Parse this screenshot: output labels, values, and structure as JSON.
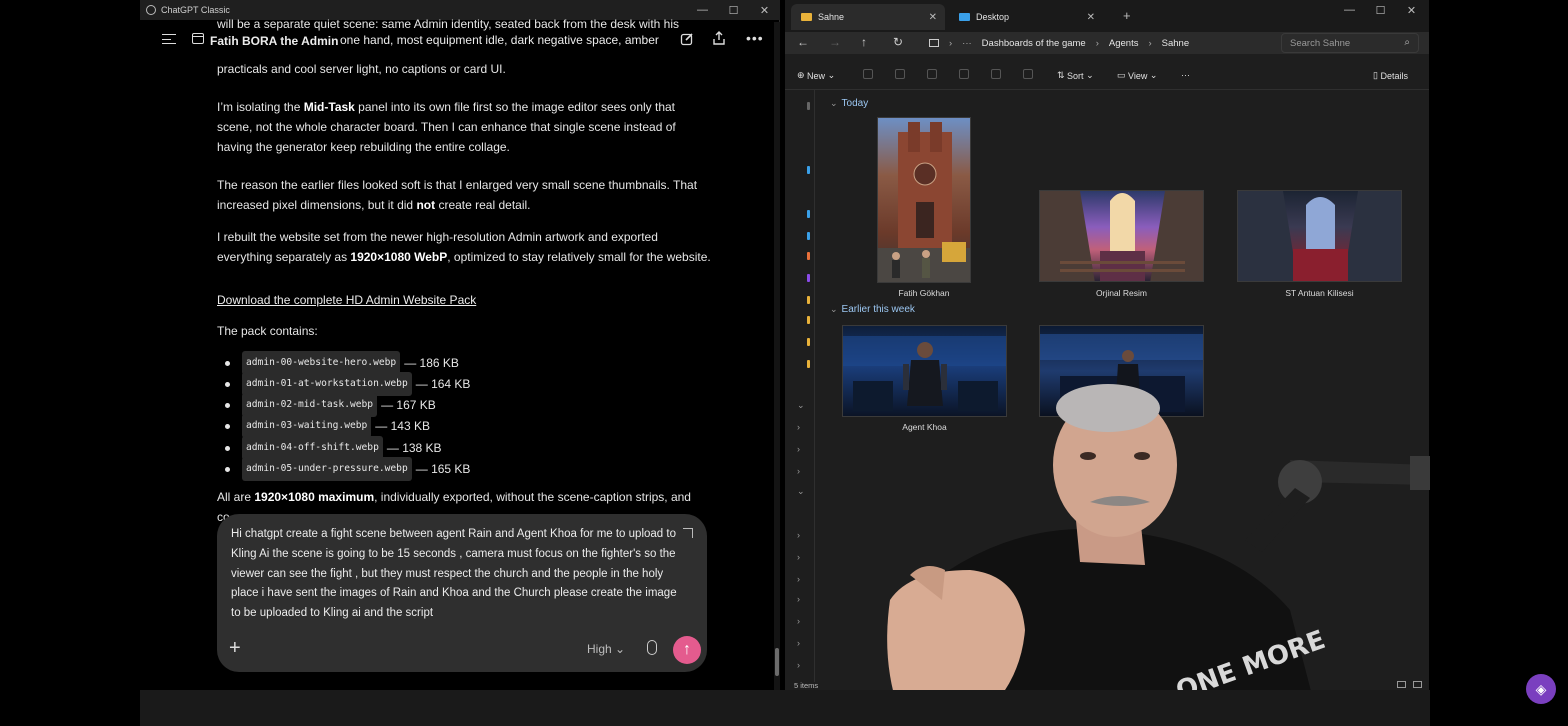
{
  "chat": {
    "window_title": "ChatGPT Classic",
    "project_name": "Fatih BORA the Admin",
    "header_overlay_text": "one hand, most equipment idle, dark negative space, amber",
    "para0_top_cut": "will be a separate quiet scene: same Admin identity, seated back from the desk with his",
    "para0_line2": "practicals and cool server light, no captions or card UI.",
    "para1_pre": "I’m isolating the ",
    "para1_bold": "Mid-Task",
    "para1_post": " panel into its own file first so the image editor sees only that scene, not the whole character board. Then I can enhance that single scene instead of having the generator keep rebuilding the entire collage.",
    "para2_pre": "The reason the earlier files looked soft is that I enlarged very small scene thumbnails. That increased pixel dimensions, but it did ",
    "para2_bold": "not",
    "para2_post": " create real detail.",
    "para3_pre": "I rebuilt the website set from the newer high-resolution Admin artwork and exported everything separately as ",
    "para3_bold": "1920×1080 WebP",
    "para3_post": ", optimized to stay relatively small for the website.",
    "download_link": "Download the complete HD Admin Website Pack",
    "pack_intro": "The pack contains:",
    "pack_files": [
      {
        "name": "admin-00-website-hero.webp",
        "size": "— 186 KB"
      },
      {
        "name": "admin-01-at-workstation.webp",
        "size": "— 164 KB"
      },
      {
        "name": "admin-02-mid-task.webp",
        "size": "— 167 KB"
      },
      {
        "name": "admin-03-waiting.webp",
        "size": "— 143 KB"
      },
      {
        "name": "admin-04-off-shift.webp",
        "size": "— 138 KB"
      },
      {
        "name": "admin-05-under-pressure.webp",
        "size": "— 165 KB"
      }
    ],
    "para4_pre": "All are ",
    "para4_bold": "1920×1080 maximum",
    "para4_post": ", individually exported, without the scene-caption strips, and",
    "para4_cut": "co",
    "composer_text": "Hi chatgpt create a fight scene between agent Rain and Agent Khoa for me to upload to Kling Ai the scene is going to be 15 seconds , camera must focus on the fighter's so the viewer can see the fight , but they must respect the church and the people in the holy place i have sent the images of Rain and Khoa and the Church please create the image to be uploaded to Kling ai and the script",
    "model_label": "High"
  },
  "explorer": {
    "tabs": [
      {
        "label": "Sahne",
        "icon": "folder-icon"
      },
      {
        "label": "Desktop",
        "icon": "desktop-icon"
      }
    ],
    "breadcrumb": [
      "Dashboards of the game",
      "Agents",
      "Sahne"
    ],
    "search_placeholder": "Search Sahne",
    "commands": {
      "new": "New",
      "sort": "Sort",
      "view": "View",
      "details": "Details"
    },
    "groups": [
      {
        "label": "Today",
        "items": [
          "Fatih Gökhan",
          "Orjinal Resim",
          "ST Antuan Kilisesi"
        ]
      },
      {
        "label": "Earlier this week",
        "items": [
          "Agent Khoa",
          ""
        ]
      }
    ],
    "status": "5 items"
  },
  "colors": {
    "accent_send": "#e45b8e",
    "folder": "#e9b23a",
    "group_header": "#9cc7f2"
  }
}
